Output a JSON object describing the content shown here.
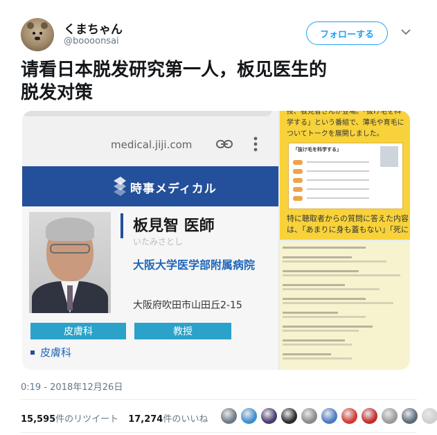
{
  "tweet": {
    "author": {
      "display_name": "くまちゃん",
      "handle": "@boooonsai"
    },
    "follow_label": "フォローする",
    "text_lines": [
      "请看日本脱发研究第一人，板见医生的",
      "脱发对策"
    ],
    "timestamp": "0:19 - 2018年12月26日",
    "retweets": {
      "count": "15,595",
      "label": "件のリツイート"
    },
    "likes": {
      "count": "17,274",
      "label": "件のいいね"
    }
  },
  "media": {
    "url": "medical.jiji.com",
    "banner_title": "時事メディカル",
    "doctor": {
      "name": "板見智 医師",
      "kana": "いたみさとし",
      "hospital": "大阪大学医学部附属病院",
      "address": "大阪府吹田市山田丘2-15",
      "tag1": "皮膚科",
      "tag2": "教授",
      "department_link": "皮膚科"
    },
    "right_top": {
      "line1": "授、板見智さんが登場。「抜け毛を科",
      "line2": "学する」という番組で、薄毛や育毛に",
      "line3": "ついてトークを展開しました。",
      "box_title": "「抜け毛を科学する」",
      "line4": "特に聴取者からの質問に答えた内容",
      "line5": "は、「あまりに身も蓋もない」「死に"
    }
  },
  "colors": {
    "accent": "#1da1f2",
    "banner": "#244f9a",
    "tag": "#2aa2c9",
    "link": "#1f66b8",
    "yellow_panel": "#f7d23a"
  },
  "likers": [
    "#6b7a88",
    "#3c8dd0",
    "#4a3b6e",
    "#2b2b2b",
    "#8a8a8a",
    "#4a79c4",
    "#d23a2f",
    "#c42b2b",
    "#9a9a9a",
    "#5a6b7a",
    "#cfcfcf",
    "#3b5a7a"
  ]
}
